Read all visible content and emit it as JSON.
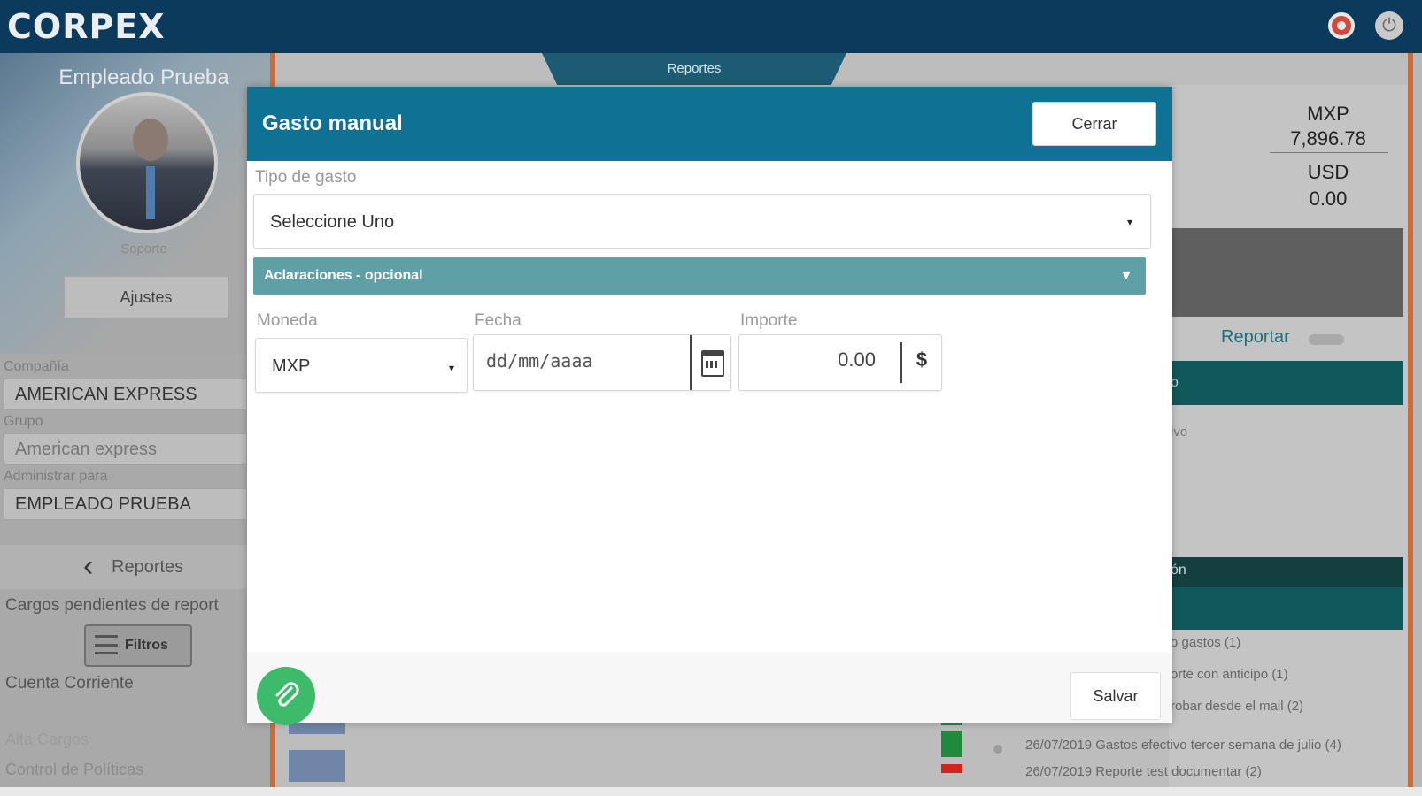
{
  "app": {
    "logo": "CORPEX"
  },
  "topbar": {
    "help_icon": "lifebuoy-icon",
    "power_icon": "power-icon",
    "power_glyph": "⏻"
  },
  "sidebar": {
    "user_name": "Empleado Prueba",
    "role": "Soporte",
    "settings_label": "Ajustes",
    "company_label": "Compañía",
    "company_value": "AMERICAN EXPRESS",
    "group_label": "Grupo",
    "group_value": "American express",
    "admin_label": "Administrar para",
    "admin_value": "EMPLEADO PRUEBA",
    "nav_back_label": "Reportes",
    "nav_back_chevron": "‹",
    "pending_label": "Cargos pendientes de report",
    "filters_label": "Filtros",
    "current_account_label": "Cuenta Corriente",
    "alta_cargos_label": "Alta Cargos",
    "control_label": "Control de Políticas"
  },
  "background": {
    "tab_label": "Reportes",
    "currency1_code": "MXP",
    "currency1_amount": "7,896.78",
    "currency2_code": "USD",
    "currency2_amount": "0.00",
    "reportar_label": "Reportar",
    "teal_bar_text": "o",
    "dim_text": "ivo",
    "dark_header_text": "ón",
    "history": [
      "o gastos (1)",
      "orte con anticipo (1)",
      "robar desde el mail (2)",
      "26/07/2019  Gastos efectivo tercer semana de julio (4)",
      "26/07/2019  Reporte test documentar (2)"
    ],
    "colors": {
      "status_green": "#1f8a3c",
      "status_red": "#d2241d"
    }
  },
  "modal": {
    "title": "Gasto manual",
    "close_label": "Cerrar",
    "expense_type_label": "Tipo de gasto",
    "expense_type_value": "Seleccione Uno",
    "clarifications_label": "Aclaraciones - opcional",
    "currency_label": "Moneda",
    "currency_value": "MXP",
    "date_label": "Fecha",
    "date_placeholder": "dd/mm/aaaa",
    "amount_label": "Importe",
    "amount_value": "0.00",
    "amount_currency_symbol": "$",
    "save_label": "Salvar",
    "caret_glyph": "▾",
    "collapse_glyph": "▼",
    "colors": {
      "header": "#0f7295",
      "collapse": "#5f9fa6",
      "attach": "#3dbb6b"
    }
  }
}
